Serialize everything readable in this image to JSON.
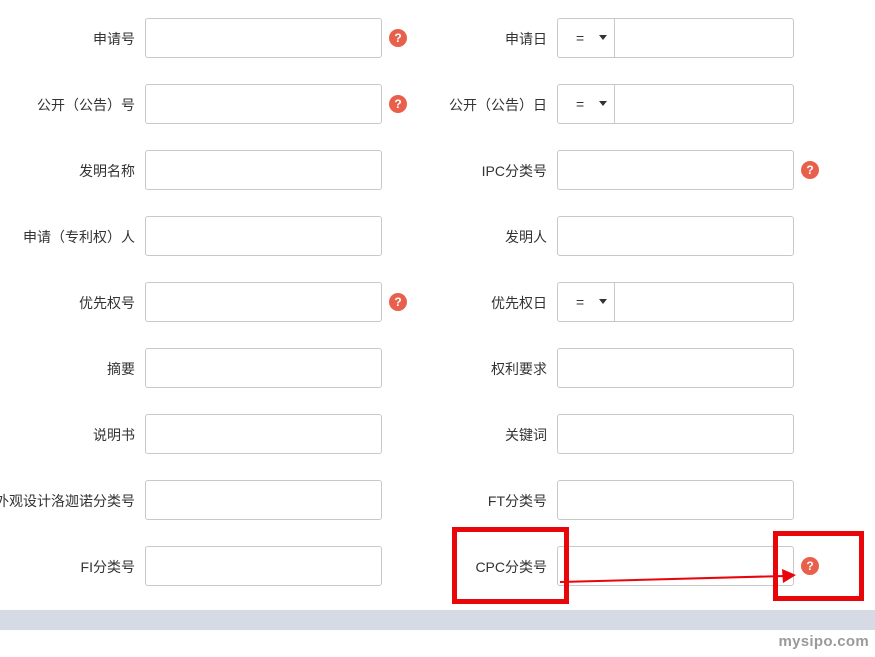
{
  "accent_colors": {
    "help_icon": "#e8604c",
    "highlight": "#e8060b",
    "footer_bar": "#d5dae5"
  },
  "form": {
    "rows": [
      {
        "left": {
          "label": "申请号",
          "help": "?"
        },
        "right": {
          "label": "申请日",
          "operator": "="
        }
      },
      {
        "left": {
          "label": "公开（公告）号",
          "help": "?"
        },
        "right": {
          "label": "公开（公告）日",
          "operator": "="
        }
      },
      {
        "left": {
          "label": "发明名称"
        },
        "right": {
          "label": "IPC分类号",
          "help": "?"
        }
      },
      {
        "left": {
          "label": "申请（专利权）人"
        },
        "right": {
          "label": "发明人"
        }
      },
      {
        "left": {
          "label": "优先权号",
          "help": "?"
        },
        "right": {
          "label": "优先权日",
          "operator": "="
        }
      },
      {
        "left": {
          "label": "摘要"
        },
        "right": {
          "label": "权利要求"
        }
      },
      {
        "left": {
          "label": "说明书"
        },
        "right": {
          "label": "关键词"
        }
      },
      {
        "left": {
          "label": "外观设计洛迦诺分类号"
        },
        "right": {
          "label": "FT分类号"
        }
      },
      {
        "left": {
          "label": "FI分类号"
        },
        "right": {
          "label": "CPC分类号",
          "help": "?"
        }
      }
    ]
  },
  "watermark": "mysipo.com"
}
